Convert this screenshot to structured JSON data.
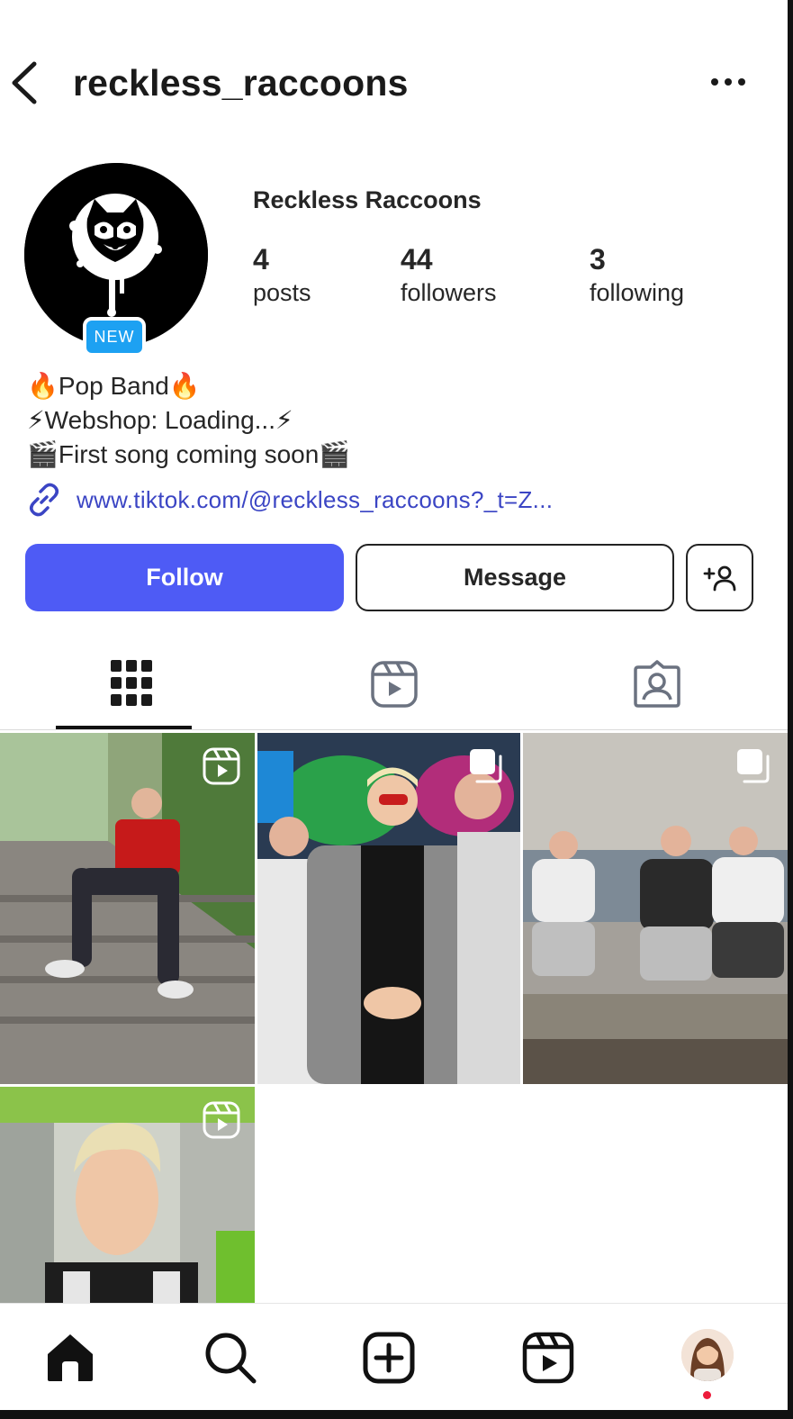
{
  "header": {
    "username": "reckless_raccoons",
    "back_icon": "chevron-left-icon",
    "more_icon": "more-horizontal-icon"
  },
  "profile": {
    "display_name": "Reckless Raccoons",
    "badge": "NEW",
    "stats": {
      "posts": {
        "value": "4",
        "label": "posts"
      },
      "followers": {
        "value": "44",
        "label": "followers"
      },
      "following": {
        "value": "3",
        "label": "following"
      }
    },
    "bio": [
      "🔥Pop Band🔥",
      "⚡Webshop: Loading...⚡",
      "🎬First song coming soon🎬"
    ],
    "link": "www.tiktok.com/@reckless_raccoons?_t=Z..."
  },
  "actions": {
    "follow_label": "Follow",
    "message_label": "Message",
    "add_user_icon": "add-user-icon"
  },
  "tabs": [
    {
      "name": "posts-grid",
      "icon": "grid-icon",
      "active": true
    },
    {
      "name": "reels",
      "icon": "reels-icon",
      "active": false
    },
    {
      "name": "tagged",
      "icon": "tagged-user-icon",
      "active": false
    }
  ],
  "posts": [
    {
      "type": "reel",
      "badge_icon": "reels-icon"
    },
    {
      "type": "carousel",
      "badge_icon": "carousel-icon"
    },
    {
      "type": "carousel",
      "badge_icon": "carousel-icon"
    },
    {
      "type": "reel",
      "badge_icon": "reels-icon"
    }
  ],
  "bottom_nav": [
    "home-icon",
    "search-icon",
    "create-icon",
    "reels-icon",
    "profile-avatar"
  ],
  "colors": {
    "follow_button": "#4e5bf5",
    "link_text": "#3b45c4",
    "new_badge": "#1da1f2",
    "notification_dot": "#ed1c3b"
  }
}
